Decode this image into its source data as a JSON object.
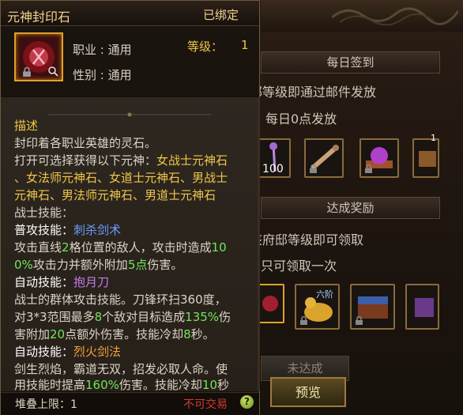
{
  "tooltip": {
    "title": "元神封印石",
    "bound": "已绑定",
    "profession": "职业 : 通用",
    "gender": "性别 : 通用",
    "level_label": "等级：",
    "level_value": "1",
    "desc_header": "描述",
    "desc_1": "封印着各职业英雄的灵石。",
    "desc_2a": "打开可选择获得以下元神：",
    "desc_2b": "女战士元神石",
    "desc_3a": "、女法师元神石",
    "desc_3b": "、",
    "desc_3c": "女道士元神石",
    "desc_3d": "、",
    "desc_3e": "男战士",
    "desc_4a": "元神石",
    "desc_4b": "、",
    "desc_4c": "男法师元神石",
    "desc_4d": "、",
    "desc_4e": "男道士元神石",
    "warrior_skills": "战士技能：",
    "skill1_label": "普攻技能：",
    "skill1_name": "刺杀剑术",
    "skill1_l1a": "攻击直线",
    "skill1_l1b": "2",
    "skill1_l1c": "格位置的敌人，攻击时造成",
    "skill1_l1d": "10",
    "skill1_l2a": "0%",
    "skill1_l2b": "攻击力并额外附加",
    "skill1_l2c": "5点",
    "skill1_l2d": "伤害。",
    "skill2_label": "自动技能：",
    "skill2_name": "抱月刀",
    "skill2_l1": "战士的群体攻击技能。刀锋环扫360度，",
    "skill2_l2a": "对3*3范围最多",
    "skill2_l2b": "8",
    "skill2_l2c": "个敌对目标造成",
    "skill2_l2d": "135%",
    "skill2_l2e": "伤",
    "skill2_l3a": "害附加",
    "skill2_l3b": "20",
    "skill2_l3c": "点额外伤害。技能冷却",
    "skill2_l3d": "8",
    "skill2_l3e": "秒。",
    "skill3_label": "自动技能：",
    "skill3_name": "烈火剑法",
    "skill3_l1": "剑生烈焰，霸道无双，招发必取人命。使",
    "skill3_l2a": "用技能时提高",
    "skill3_l2b": "160%",
    "skill3_l2c": "伤害。技能冷却",
    "skill3_l2d": "10",
    "skill3_l2e": "秒",
    "stack_limit": "堆叠上限：1",
    "no_trade": "不可交易",
    "help": "?"
  },
  "panel": {
    "daily_header": "每日签到",
    "daily_line1": "邸等级即通过邮件发放",
    "daily_line2": "每日0点发放",
    "slot_count_100": "100",
    "slot_badge_1": "1",
    "reward_header": "达成奖励",
    "reward_line1": "该府邸等级即可领取",
    "reward_line2": "只可领取一次",
    "slot_label_six": "六阶",
    "not_reached_button": "未达成",
    "preview_button": "预览"
  },
  "colors": {
    "gold": "#f0c64a",
    "green": "#6fe65a",
    "blue": "#6f9cff",
    "purple": "#c17be8",
    "orange": "#f0a33e",
    "red": "#d23a2a"
  }
}
